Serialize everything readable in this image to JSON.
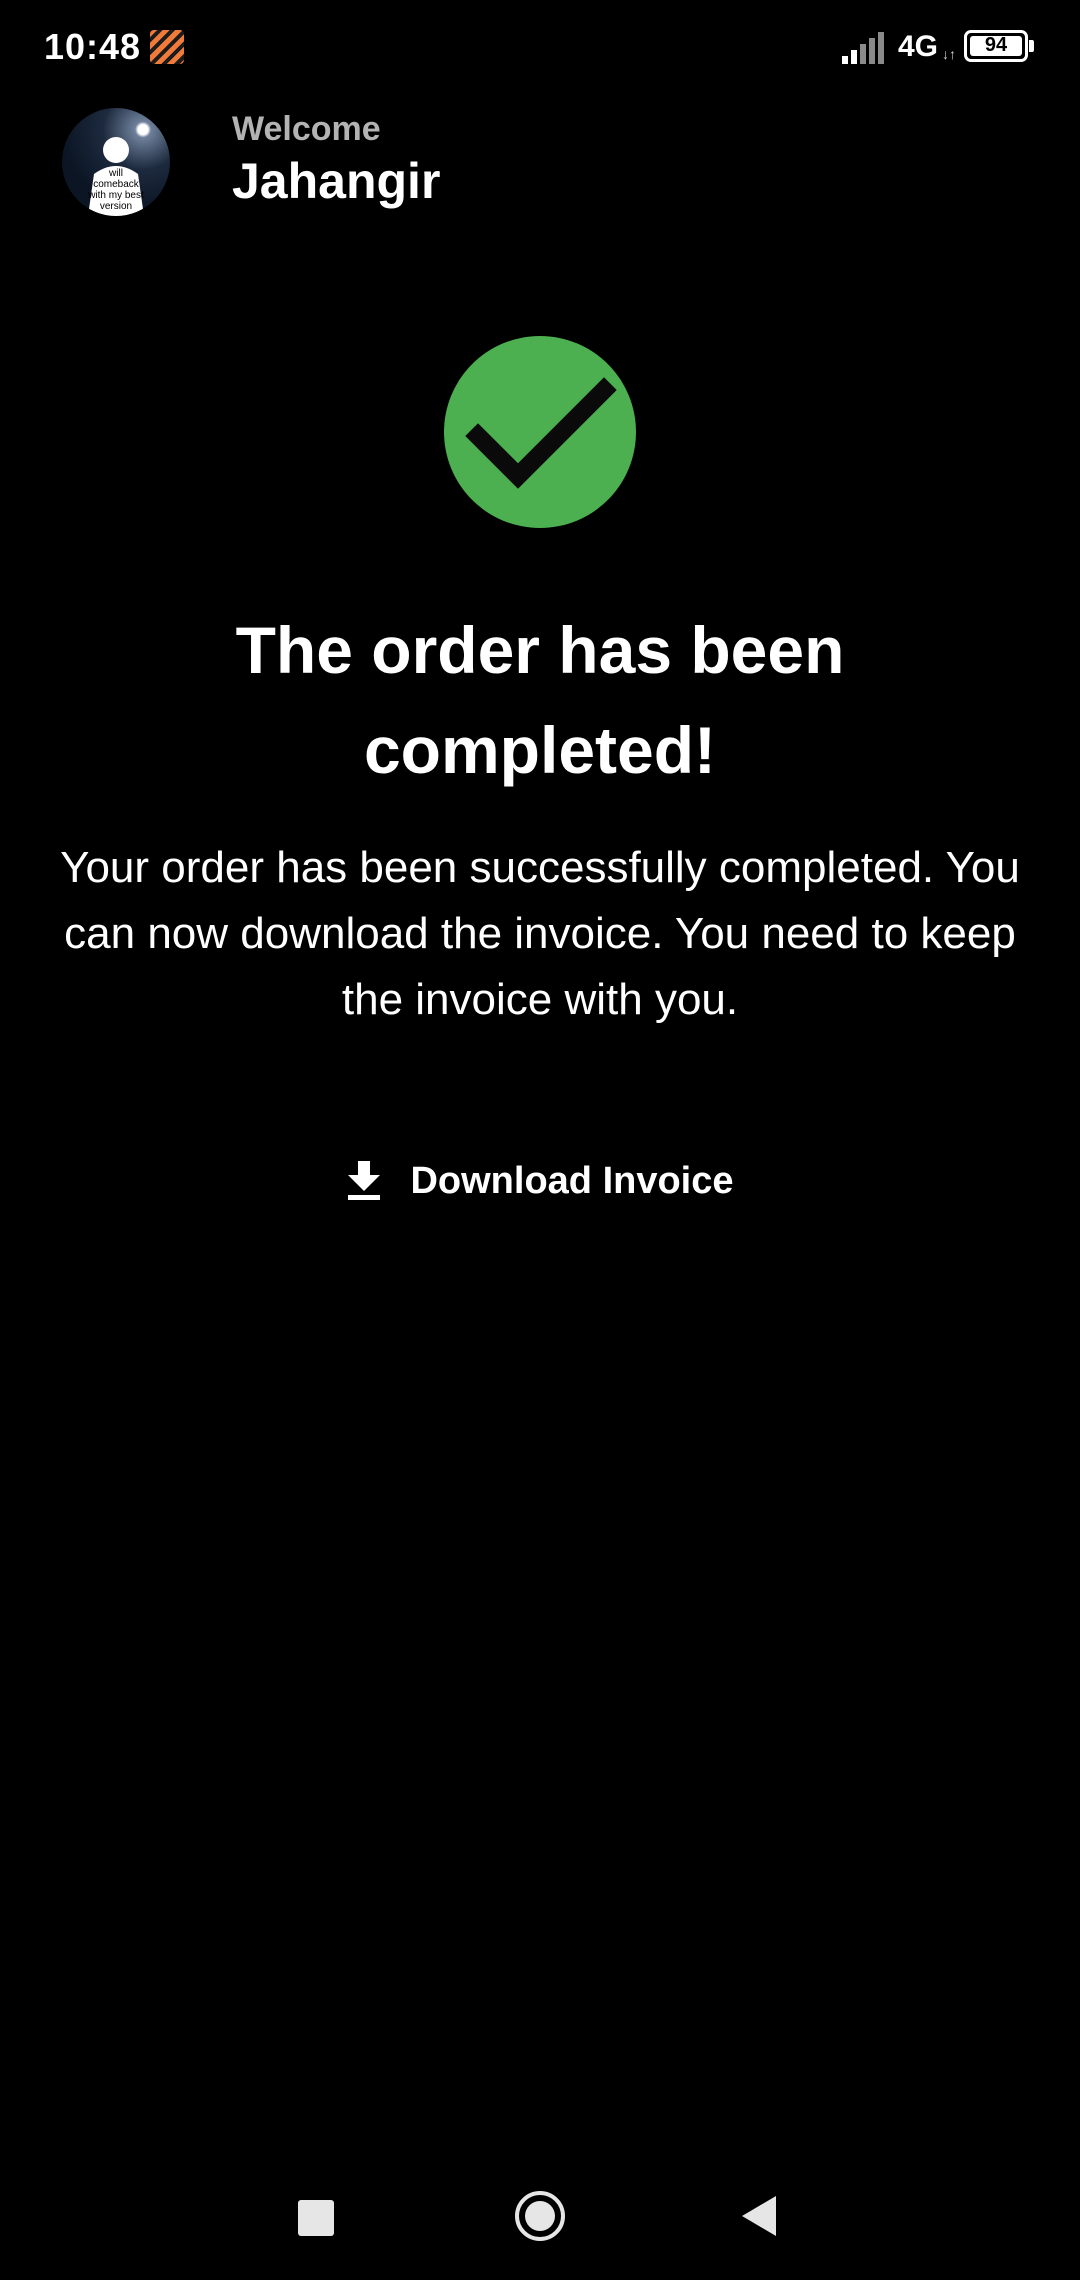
{
  "status_bar": {
    "time": "10:48",
    "network": "4G",
    "network_arrows": "↓↑",
    "battery": "94",
    "icons": [
      "app-notification-icon",
      "signal-icon",
      "battery-icon"
    ]
  },
  "header": {
    "welcome": "Welcome",
    "user_name": "Jahangir",
    "avatar_caption": "will comeback with my best version"
  },
  "success": {
    "icon": "check-circle-icon",
    "icon_color": "#4caf50",
    "title": "The order has been completed!",
    "message": "Your order has been successfully completed. You can now download the invoice. You need to keep the invoice with you."
  },
  "actions": {
    "download_label": "Download Invoice",
    "download_icon": "download-icon"
  },
  "nav_bar": {
    "icons": [
      "recents-icon",
      "home-icon",
      "back-icon"
    ]
  }
}
